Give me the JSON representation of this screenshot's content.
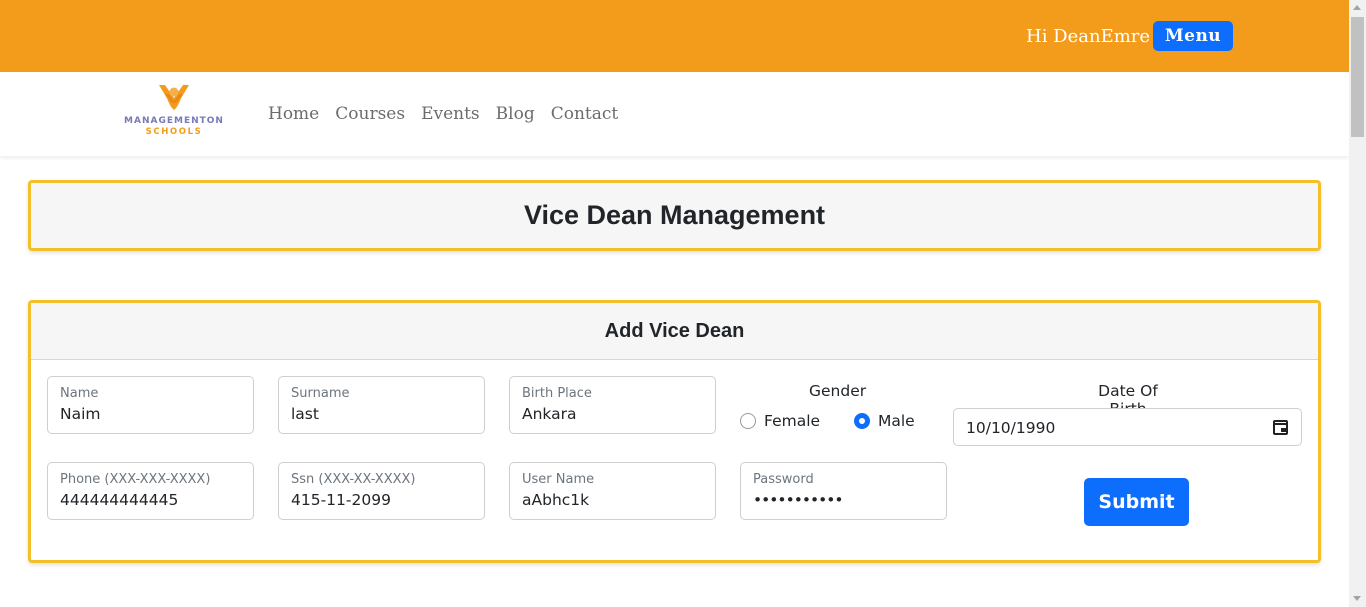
{
  "header": {
    "greeting": "Hi DeanEmre",
    "menu_label": "Menu"
  },
  "brand": {
    "logo_icon": "school-logo-icon",
    "line1": "MANAGEMENTON",
    "line2": "SCHOOLS"
  },
  "nav": {
    "items": [
      {
        "label": "Home"
      },
      {
        "label": "Courses"
      },
      {
        "label": "Events"
      },
      {
        "label": "Blog"
      },
      {
        "label": "Contact"
      }
    ]
  },
  "page": {
    "title": "Vice Dean Management"
  },
  "form": {
    "title": "Add Vice Dean",
    "name": {
      "label": "Name",
      "value": "Naim"
    },
    "surname": {
      "label": "Surname",
      "value": "last"
    },
    "birth_place": {
      "label": "Birth Place",
      "value": "Ankara"
    },
    "gender": {
      "label": "Gender",
      "options": [
        {
          "label": "Female",
          "checked": false
        },
        {
          "label": "Male",
          "checked": true
        }
      ]
    },
    "date_of_birth": {
      "label": "Date Of Birth",
      "value": "10/10/1990"
    },
    "phone": {
      "label": "Phone (XXX-XXX-XXXX)",
      "value": "444444444445"
    },
    "ssn": {
      "label": "Ssn (XXX-XX-XXXX)",
      "value": "415-11-2099"
    },
    "username": {
      "label": "User Name",
      "value": "aAbhc1k"
    },
    "password": {
      "label": "Password",
      "value": "•••••••••••"
    },
    "submit_label": "Submit"
  },
  "colors": {
    "topbar": "#f39c1b",
    "primary": "#0d6efd",
    "card_border": "#f4c02a"
  }
}
